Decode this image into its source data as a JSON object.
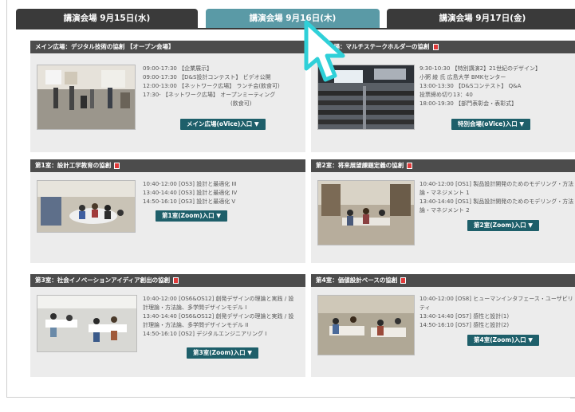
{
  "tabs": [
    {
      "label": "講演会場 9月15日(水)",
      "active": false
    },
    {
      "label": "講演会場 9月16日(木)",
      "active": true
    },
    {
      "label": "講演会場 9月17日(金)",
      "active": false
    }
  ],
  "cards": {
    "main_plaza": {
      "title": "メイン広場：デジタル技術の協創 【オープン会場】",
      "schedule": [
        "09:00-17:30 【企業展示】",
        "09:00-17:30 【D&S設計コンテスト】 ビデオ公開",
        "12:00-13:00 【ネットワーク広場】 ランチ会(飲食可)",
        "17:30-         【ネットワーク広場】 オープンミーティング"
      ],
      "schedule_sub": "(飲食可)",
      "button": "メイン広場(oVice)入口 ▼"
    },
    "special_hall": {
      "title": "特別会場：マルチステークホルダーの協創",
      "schedule": [
        "9:30-10:30 【特別講演2】21世紀のデザイン】",
        "              小粥 綾 氏 広島大学 BMKセンター",
        "13:00-13:30 【D&Sコンテスト】 Q&A",
        "              投票締め切り13：40",
        "18:00-19:30 【部門表彰会・表彰式】"
      ],
      "button": "特別会場(oVice)入口 ▼"
    },
    "room1": {
      "title": "第1室：設計工学教育の協創",
      "schedule": [
        "10:40-12:00 [OS3] 設計と最適化 III",
        "13:40-14:40 [OS3] 設計と最適化 IV",
        "14:50-16:10 [OS3] 設計と最適化 V"
      ],
      "button": "第1室(Zoom)入口 ▼"
    },
    "room2": {
      "title": "第2室：将来展望課題定義の協創",
      "schedule": [
        "10:40-12:00 [OS1] 製品設計開発のためのモデリング・方法",
        "              論・マネジメント 1",
        "13:40-14:40 [OS1] 製品設計開発のためのモデリング・方法",
        "              論・マネジメント 2"
      ],
      "button": "第2室(Zoom)入口 ▼"
    },
    "room3": {
      "title": "第3室：社会イノベーションアイディア創出の協創",
      "schedule": [
        "10:40-12:00 [OS6&OS12] 創発デザインの理論と実践 / 設",
        "              計理論・方法論、多学問デザインモデル I",
        "13:40-14:40 [OS6&OS12] 創発デザインの理論と実践 / 設",
        "              計理論・方法論、多学問デザインモデル II",
        "14:50-16:10 [OS2] デジタルエンジニアリング I"
      ],
      "button": "第3室(Zoom)入口 ▼"
    },
    "room4": {
      "title": "第4室：価値設計ベースの協創",
      "schedule": [
        "10:40-12:00 [OS8] ヒューマンインタフェース・ユーザビリ",
        "              ティ",
        "13:40-14:40 [OS7] 感性と設計(1)",
        "14:50-16:10 [OS7] 感性と設計(2)"
      ],
      "button": "第4室(Zoom)入口 ▼"
    }
  },
  "colors": {
    "tab_dark": "#3a3a3a",
    "tab_active": "#5a9aa6",
    "header": "#4c4c4c",
    "button": "#1e5f6a",
    "card_bg": "#ececec",
    "pdf_icon": "#e03a3a",
    "cursor_fill": "#ffffff",
    "cursor_outline": "#2fd0d8"
  },
  "icons": [
    "pdf-icon",
    "mouse-cursor-icon"
  ]
}
